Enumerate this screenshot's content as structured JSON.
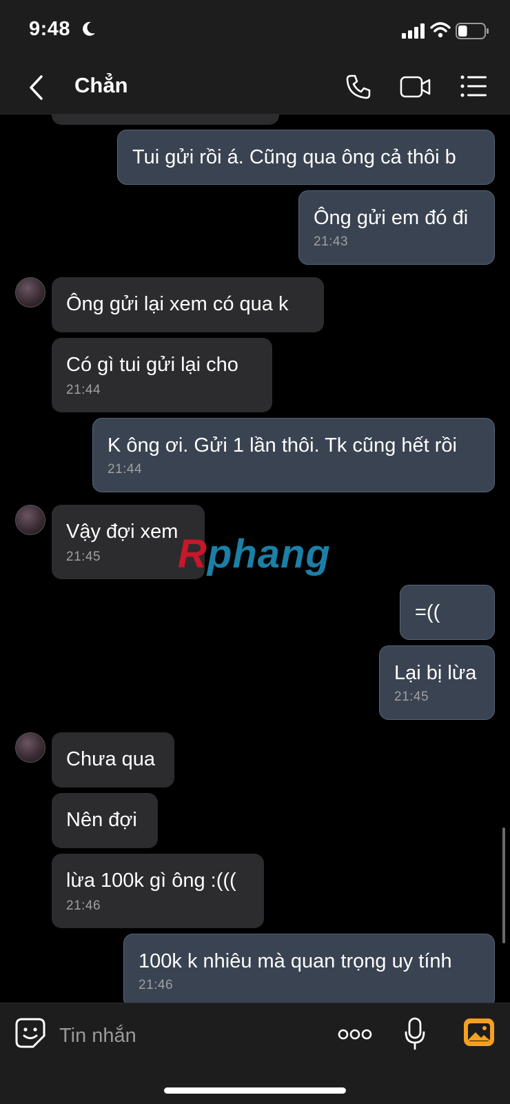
{
  "status_bar": {
    "time": "9:48",
    "battery_level": 0.35
  },
  "header": {
    "contact_name": "Chẳn"
  },
  "messages": [
    {
      "side": "out",
      "text": "Tui gửi rồi á. Cũng qua ông cả thôi b"
    },
    {
      "side": "out",
      "text": "Ông gửi em đó đi",
      "time": "21:43"
    },
    {
      "side": "in",
      "text": "Ông gửi lại  xem có qua k"
    },
    {
      "side": "in",
      "text": "Có gì tui gửi lại cho",
      "time": "21:44"
    },
    {
      "side": "out",
      "text": "K ông ơi. Gửi 1 lần thôi. Tk cũng hết rồi",
      "time": "21:44"
    },
    {
      "side": "in",
      "text": "Vậy đợi xem",
      "time": "21:45"
    },
    {
      "side": "out",
      "text": "=(("
    },
    {
      "side": "out",
      "text": "Lại bị lừa",
      "time": "21:45"
    },
    {
      "side": "in",
      "text": "Chưa qua"
    },
    {
      "side": "in",
      "text": "Nên đợi"
    },
    {
      "side": "in",
      "text": "lừa 100k gì ông :(((",
      "time": "21:46"
    },
    {
      "side": "out",
      "text": "100k k nhiêu mà quan trọng uy tính",
      "time": "21:46"
    }
  ],
  "watermark": {
    "part1": "R",
    "part2": "phang"
  },
  "composer": {
    "placeholder": "Tin nhắn"
  },
  "icons": {
    "back": "chevron-left-icon",
    "call": "phone-icon",
    "video": "video-camera-icon",
    "menu": "list-menu-icon",
    "sticker": "sticker-icon",
    "more": "more-dots-icon",
    "mic": "microphone-icon",
    "photo": "photo-gallery-icon"
  },
  "colors": {
    "incoming_bubble": "#2c2c2e",
    "outgoing_bubble": "#3a4351",
    "photo_icon": "#f5a020"
  }
}
